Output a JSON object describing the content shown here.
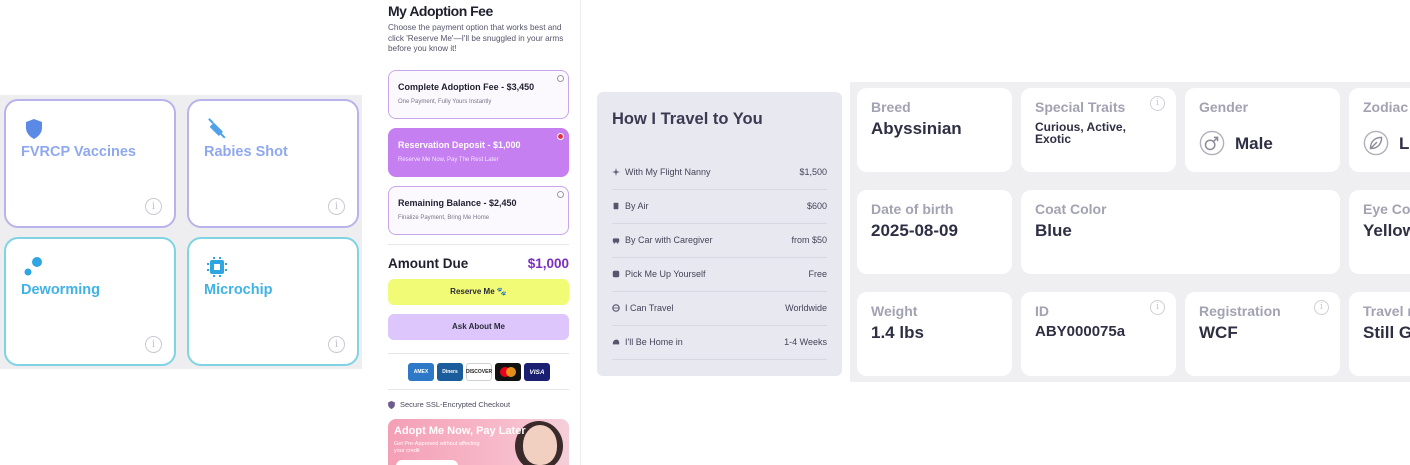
{
  "health": {
    "items": [
      {
        "label": "FVRCP Vaccines",
        "icon": "shield-icon",
        "color": "#8fa8ee"
      },
      {
        "label": "Rabies Shot",
        "icon": "syringe-icon",
        "color": "#8fa8ee"
      },
      {
        "label": "Deworming",
        "icon": "dots-icon",
        "color": "#3fb2e6"
      },
      {
        "label": "Microchip",
        "icon": "chip-icon",
        "color": "#3fb2e6"
      }
    ],
    "info_glyph": "i"
  },
  "fee": {
    "title": "My Adoption Fee",
    "description": "Choose the payment option that works best and click 'Reserve Me'—I'll be snuggled in your arms before you know it!",
    "options": [
      {
        "title": "Complete Adoption Fee - $3,450",
        "subtitle": "One Payment, Fully Yours Instantly",
        "selected": false
      },
      {
        "title": "Reservation Deposit - $1,000",
        "subtitle": "Reserve Me Now, Pay The Rest Later",
        "selected": true
      },
      {
        "title": "Remaining Balance - $2,450",
        "subtitle": "Finalize Payment, Bring Me Home",
        "selected": false
      }
    ],
    "amount_due_label": "Amount Due",
    "amount_due_value": "$1,000",
    "reserve_button": "Reserve Me 🐾",
    "ask_button": "Ask About Me",
    "payment_cards": [
      "AMEX",
      "Diners",
      "DISCOVER",
      "Mastercard",
      "VISA"
    ],
    "secure_text": "Secure SSL-Encrypted Checkout",
    "promo": {
      "title": "Adopt Me Now, Pay Later",
      "subtitle": "Get Pre-Approved without affecting your credit"
    },
    "accent_color": "#c57ff0"
  },
  "travel": {
    "title": "How I Travel to You",
    "rows": [
      {
        "label": "With My Flight Nanny",
        "value": "$1,500",
        "icon": "plane-icon"
      },
      {
        "label": "By Air",
        "value": "$600",
        "icon": "luggage-icon"
      },
      {
        "label": "By Car with Caregiver",
        "value": "from $50",
        "icon": "car-icon"
      },
      {
        "label": "Pick Me Up Yourself",
        "value": "Free",
        "icon": "pin-icon"
      },
      {
        "label": "I Can Travel",
        "value": "Worldwide",
        "icon": "globe-icon"
      },
      {
        "label": "I'll Be Home in",
        "value": "1-4 Weeks",
        "icon": "clock-icon"
      }
    ]
  },
  "details": {
    "breed": {
      "label": "Breed",
      "value": "Abyssinian"
    },
    "traits": {
      "label": "Special Traits",
      "value": "Curious, Active, Exotic"
    },
    "gender": {
      "label": "Gender",
      "value": "Male",
      "icon": "male-icon"
    },
    "zodiac": {
      "label": "Zodiac",
      "value": "Leo",
      "icon": "leaf-icon"
    },
    "dob": {
      "label": "Date of birth",
      "value": "2025-08-09"
    },
    "coat": {
      "label": "Coat Color",
      "value": "Blue"
    },
    "eye": {
      "label": "Eye Color",
      "value": "Yellow"
    },
    "weight": {
      "label": "Weight",
      "value": "1.4 lbs"
    },
    "id": {
      "label": "ID",
      "value": "ABY000075a"
    },
    "registration": {
      "label": "Registration",
      "value": "WCF"
    },
    "travel": {
      "label": "Travel ready",
      "value": "Still Growing"
    }
  }
}
